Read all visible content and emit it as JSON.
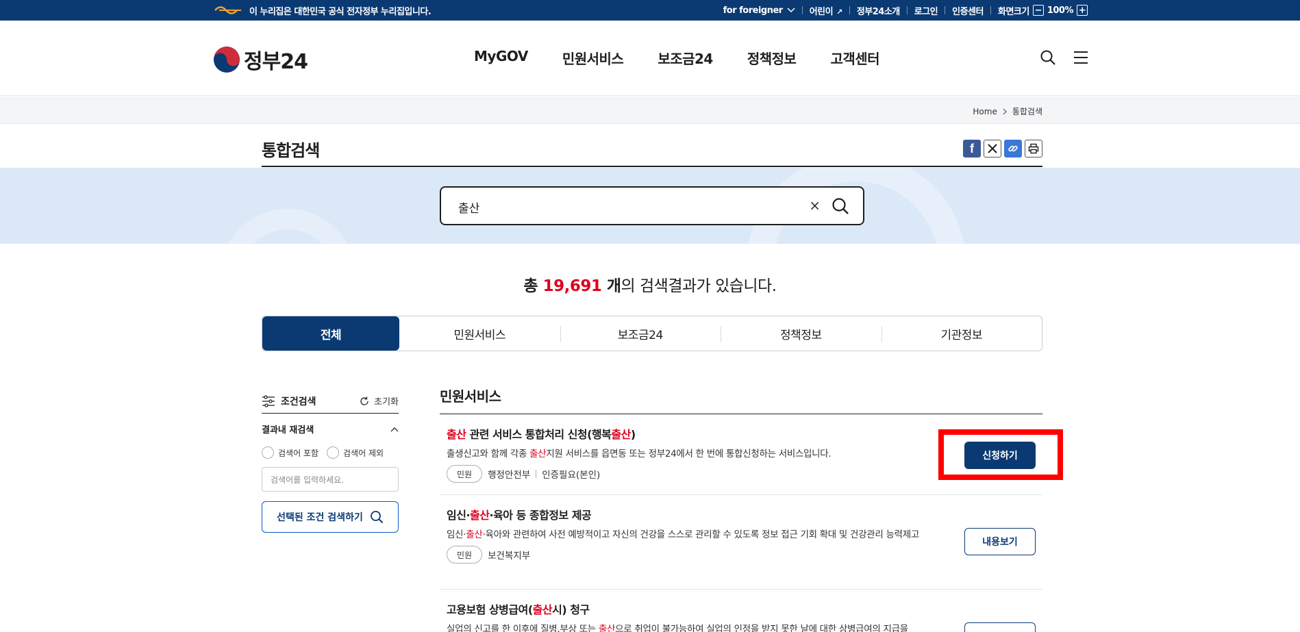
{
  "gov_bar": {
    "notice": "이 누리집은 대한민국 공식 전자정부 누리집입니다.",
    "foreigner": "for foreigner",
    "kids": "어린이",
    "about": "정부24소개",
    "login": "로그인",
    "cert": "인증센터",
    "screen_size": "화면크기",
    "zoom_minus": "−",
    "zoom_value": "100%",
    "zoom_plus": "+"
  },
  "header": {
    "logo_text": "정부24",
    "nav": [
      "MyGOV",
      "민원서비스",
      "보조금24",
      "정책정보",
      "고객센터"
    ]
  },
  "breadcrumb": {
    "home": "Home",
    "current": "통합검색"
  },
  "page_title": "통합검색",
  "search": {
    "value": "출산",
    "clear": "×"
  },
  "result_count": {
    "prefix": "총 ",
    "number": "19,691",
    "unit": " 개",
    "suffix": "의 검색결과가 있습니다."
  },
  "tabs": [
    "전체",
    "민원서비스",
    "보조금24",
    "정책정보",
    "기관정보"
  ],
  "filter": {
    "title": "조건검색",
    "reset": "초기화",
    "re_search": "결과내 재검색",
    "include": "검색어 포함",
    "exclude": "검색어 제외",
    "input_placeholder": "검색어를 입력하세요.",
    "apply": "선택된 조건 검색하기"
  },
  "results": {
    "section_title": "민원서비스",
    "items": [
      {
        "title_parts": [
          "출산",
          " 관련 서비스 통합처리 신청(행복",
          "출산",
          ")"
        ],
        "desc_parts": [
          "출생신고와 함께 각종 ",
          "출산",
          "지원 서비스를 읍면동 또는 정부24에서 한 번에 통합신청하는 서비스입니다."
        ],
        "tag": "민원",
        "org": "행정안전부",
        "extra": "인증필요(본인)",
        "button": "신청하기"
      },
      {
        "title_parts": [
          "임신·",
          "출산",
          "·육아 등 종합정보 제공"
        ],
        "desc_parts": [
          "임신·",
          "출산",
          "·육아와 관련하여 사전 예방적이고 자신의 건강을 스스로 관리할 수 있도록 정보 접근 기회 확대 및 건강관리 능력제고"
        ],
        "tag": "민원",
        "org": "보건복지부",
        "button": "내용보기"
      },
      {
        "title_parts": [
          "고용보험 상병급여(",
          "출산",
          "시) 청구"
        ],
        "desc_parts": [
          "실업의 신고를 한 이후에 질병,부상 또는 ",
          "출산",
          "으로 취업이 불가능하여 실업의 인정을 받지 못한 날에 대한 상병급여의 지급을"
        ]
      }
    ]
  },
  "colors": {
    "brand_navy": "#0b3a73",
    "highlight_red": "#e0001f",
    "search_band": "#dbe8f7"
  }
}
